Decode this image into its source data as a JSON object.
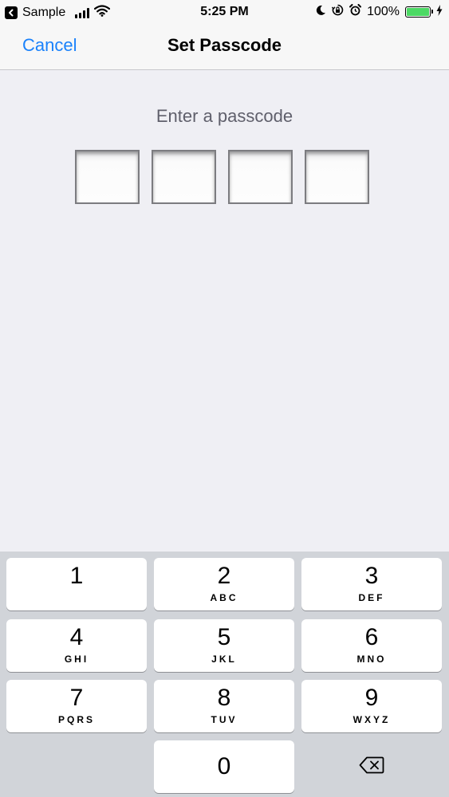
{
  "status_bar": {
    "back_app": "Sample",
    "time": "5:25 PM",
    "battery": "100%"
  },
  "nav": {
    "cancel": "Cancel",
    "title": "Set Passcode"
  },
  "prompt": "Enter a passcode",
  "passcode": {
    "length": 4,
    "entered": 0
  },
  "keys": [
    {
      "num": "1",
      "letters": ""
    },
    {
      "num": "2",
      "letters": "ABC"
    },
    {
      "num": "3",
      "letters": "DEF"
    },
    {
      "num": "4",
      "letters": "GHI"
    },
    {
      "num": "5",
      "letters": "JKL"
    },
    {
      "num": "6",
      "letters": "MNO"
    },
    {
      "num": "7",
      "letters": "PQRS"
    },
    {
      "num": "8",
      "letters": "TUV"
    },
    {
      "num": "9",
      "letters": "WXYZ"
    },
    {
      "num": "0",
      "letters": ""
    }
  ],
  "icons": {
    "back": "back-arrow-icon",
    "signal": "signal-bars-icon",
    "wifi": "wifi-icon",
    "moon": "do-not-disturb-icon",
    "lock": "orientation-lock-icon",
    "alarm": "alarm-icon",
    "battery": "battery-icon",
    "charging": "charging-bolt-icon",
    "delete": "delete-backspace-icon"
  },
  "colors": {
    "accent": "#1a82fb",
    "background": "#efeff4",
    "keypad_bg": "#d1d4d9",
    "battery_fill": "#4cd964"
  }
}
